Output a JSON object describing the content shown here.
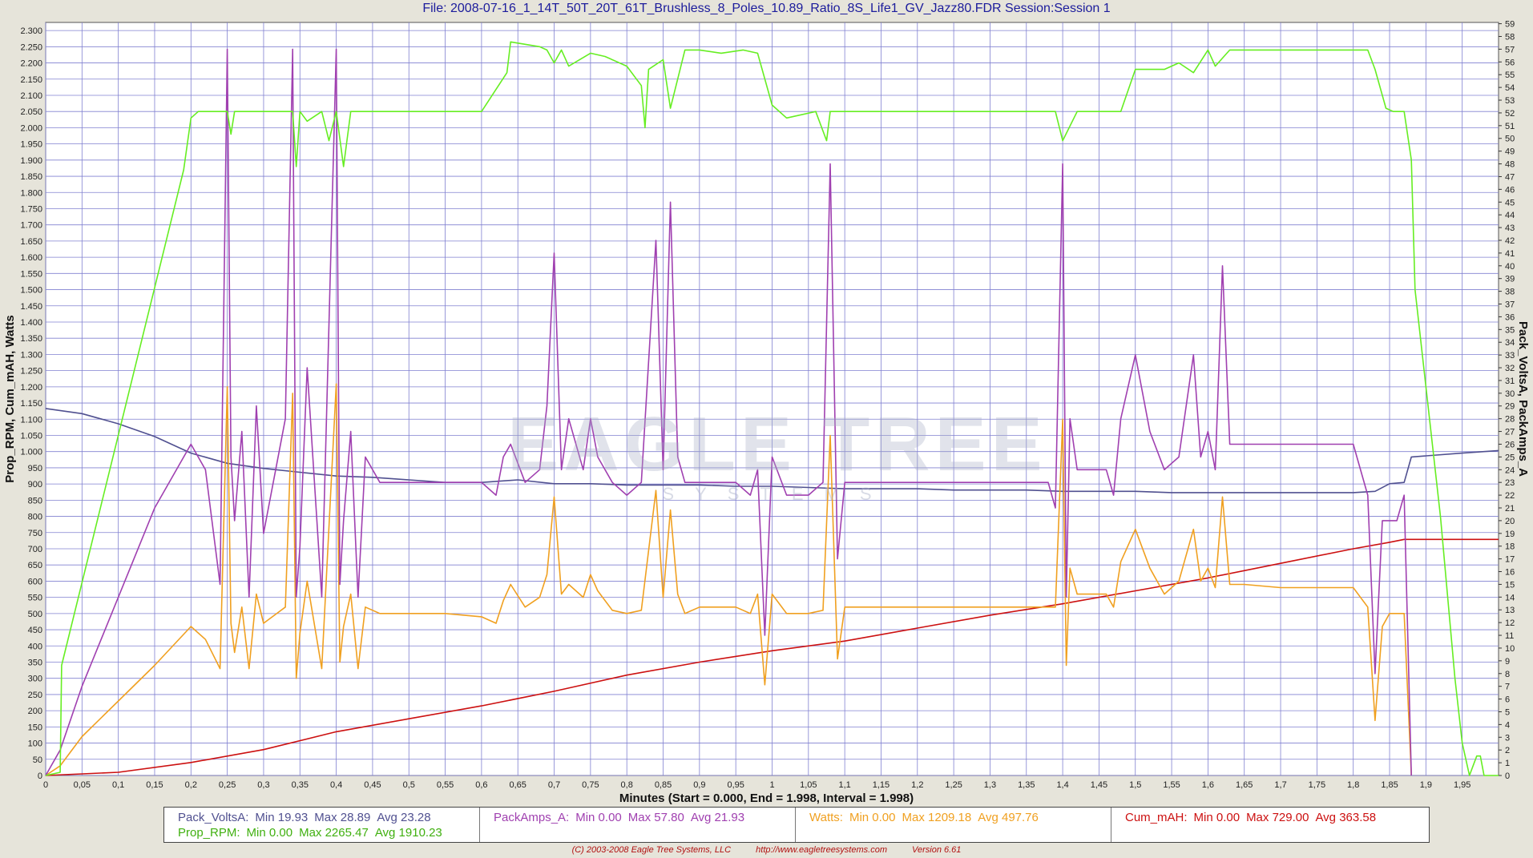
{
  "title": "File: 2008-07-16_1_14T_50T_20T_61T_Brushless_8_Poles_10.89_Ratio_8S_Life1_GV_Jazz80.FDR   Session:Session 1",
  "watermark": "EAGLE TREE",
  "watermark_sub": "SYSTEMS",
  "xlabel": "Minutes (Start = 0.000,  End = 1.998,  Interval =  1.998)",
  "ylabel_left": "Prop_RPM, Cum_mAH, Watts",
  "ylabel_right": "Pack_VoltsA, PackAmps_A",
  "footer": {
    "copyright": "(C) 2003-2008 Eagle Tree Systems, LLC",
    "url": "http://www.eagletreesystems.com",
    "version": "Version 6.61"
  },
  "legend": {
    "volts": {
      "name": "Pack_VoltsA:",
      "min": "Min 19.93",
      "max": "Max 28.89",
      "avg": "Avg 23.28"
    },
    "rpm": {
      "name": "Prop_RPM:",
      "min": "Min 0.00",
      "max": "Max 2265.47",
      "avg": "Avg 1910.23"
    },
    "amps": {
      "name": "PackAmps_A:",
      "min": "Min 0.00",
      "max": "Max 57.80",
      "avg": "Avg 21.93"
    },
    "watts": {
      "name": "Watts:",
      "min": "Min 0.00",
      "max": "Max 1209.18",
      "avg": "Avg 497.76"
    },
    "mah": {
      "name": "Cum_mAH:",
      "min": "Min 0.00",
      "max": "Max 729.00",
      "avg": "Avg 363.58"
    }
  },
  "colors": {
    "rpm": "#66ee22",
    "volts": "#505090",
    "amps": "#a040b0",
    "watts": "#f0a020",
    "mah": "#cc1010",
    "grid": "#8080d0",
    "plot_bg": "#ffffff"
  },
  "chart_data": {
    "type": "line",
    "grid": true,
    "x_ticks": [
      "0",
      "0,05",
      "0,1",
      "0,15",
      "0,2",
      "0,25",
      "0,3",
      "0,35",
      "0,4",
      "0,45",
      "0,5",
      "0,55",
      "0,6",
      "0,65",
      "0,7",
      "0,75",
      "0,8",
      "0,85",
      "0,9",
      "0,95",
      "1",
      "1,05",
      "1,1",
      "1,15",
      "1,2",
      "1,25",
      "1,3",
      "1,35",
      "1,4",
      "1,45",
      "1,5",
      "1,55",
      "1,6",
      "1,65",
      "1,7",
      "1,75",
      "1,8",
      "1,85",
      "1,9",
      "1,95"
    ],
    "xlim": [
      0,
      2.0
    ],
    "y_left_ticks": [
      "0",
      "50",
      "100",
      "150",
      "200",
      "250",
      "300",
      "350",
      "400",
      "450",
      "500",
      "550",
      "600",
      "650",
      "700",
      "750",
      "800",
      "850",
      "900",
      "950",
      "1.000",
      "1.050",
      "1.100",
      "1.150",
      "1.200",
      "1.250",
      "1.300",
      "1.350",
      "1.400",
      "1.450",
      "1.500",
      "1.550",
      "1.600",
      "1.650",
      "1.700",
      "1.750",
      "1.800",
      "1.850",
      "1.900",
      "1.950",
      "2.000",
      "2.050",
      "2.100",
      "2.150",
      "2.200",
      "2.250",
      "2.300"
    ],
    "ylim_left": [
      0,
      2325
    ],
    "y_right_ticks": [
      "0",
      "1",
      "2",
      "3",
      "4",
      "5",
      "6",
      "7",
      "8",
      "9",
      "10",
      "11",
      "12",
      "13",
      "14",
      "15",
      "16",
      "17",
      "18",
      "19",
      "20",
      "21",
      "22",
      "23",
      "24",
      "25",
      "26",
      "27",
      "28",
      "29",
      "30",
      "31",
      "32",
      "33",
      "34",
      "35",
      "36",
      "37",
      "38",
      "39",
      "40",
      "41",
      "42",
      "43",
      "44",
      "45",
      "46",
      "47",
      "48",
      "49",
      "50",
      "51",
      "52",
      "53",
      "54",
      "55",
      "56",
      "57",
      "58",
      "59"
    ],
    "ylim_right": [
      0,
      59.1
    ],
    "series": [
      {
        "name": "Prop_RPM",
        "axis": "left",
        "x": [
          0,
          0.02,
          0.022,
          0.19,
          0.2,
          0.21,
          0.25,
          0.255,
          0.26,
          0.3,
          0.34,
          0.345,
          0.35,
          0.36,
          0.38,
          0.39,
          0.4,
          0.41,
          0.42,
          0.6,
          0.635,
          0.64,
          0.68,
          0.69,
          0.7,
          0.71,
          0.72,
          0.75,
          0.77,
          0.8,
          0.82,
          0.825,
          0.83,
          0.85,
          0.86,
          0.88,
          0.9,
          0.93,
          0.96,
          0.98,
          1.0,
          1.02,
          1.06,
          1.075,
          1.08,
          1.1,
          1.35,
          1.39,
          1.4,
          1.42,
          1.44,
          1.45,
          1.47,
          1.48,
          1.5,
          1.54,
          1.56,
          1.58,
          1.6,
          1.61,
          1.63,
          1.65,
          1.72,
          1.8,
          1.82,
          1.83,
          1.845,
          1.855,
          1.87,
          1.88,
          1.885,
          1.92,
          1.94,
          1.95,
          1.96,
          1.97,
          1.975,
          1.98,
          2.0
        ],
        "y": [
          0,
          10,
          340,
          1870,
          2030,
          2050,
          2050,
          1980,
          2050,
          2050,
          2050,
          1880,
          2050,
          2020,
          2050,
          1960,
          2050,
          1880,
          2050,
          2050,
          2170,
          2265,
          2250,
          2240,
          2200,
          2240,
          2190,
          2230,
          2220,
          2190,
          2130,
          2000,
          2180,
          2210,
          2060,
          2240,
          2240,
          2230,
          2240,
          2230,
          2070,
          2030,
          2050,
          1960,
          2050,
          2050,
          2050,
          2050,
          1960,
          2050,
          2050,
          2050,
          2050,
          2050,
          2180,
          2180,
          2200,
          2170,
          2240,
          2190,
          2240,
          2240,
          2240,
          2240,
          2240,
          2180,
          2060,
          2050,
          2050,
          1900,
          1500,
          800,
          300,
          100,
          0,
          60,
          60,
          0,
          0
        ]
      },
      {
        "name": "Pack_VoltsA",
        "axis": "right",
        "x": [
          0,
          0.05,
          0.1,
          0.15,
          0.2,
          0.25,
          0.3,
          0.35,
          0.4,
          0.45,
          0.5,
          0.55,
          0.6,
          0.65,
          0.7,
          0.75,
          0.8,
          0.85,
          0.9,
          0.95,
          1.0,
          1.05,
          1.1,
          1.15,
          1.2,
          1.25,
          1.3,
          1.35,
          1.4,
          1.45,
          1.5,
          1.55,
          1.6,
          1.65,
          1.7,
          1.75,
          1.8,
          1.83,
          1.85,
          1.87,
          1.88,
          1.95,
          2.0
        ],
        "y": [
          28.8,
          28.4,
          27.6,
          26.6,
          25.3,
          24.5,
          24.1,
          23.8,
          23.5,
          23.4,
          23.2,
          23.0,
          23.0,
          23.2,
          22.9,
          22.9,
          22.8,
          22.8,
          22.8,
          22.7,
          22.7,
          22.6,
          22.5,
          22.5,
          22.5,
          22.4,
          22.4,
          22.4,
          22.3,
          22.3,
          22.3,
          22.2,
          22.2,
          22.2,
          22.2,
          22.2,
          22.2,
          22.3,
          22.9,
          23.0,
          25.0,
          25.3,
          25.5
        ]
      },
      {
        "name": "PackAmps_A",
        "axis": "right",
        "x": [
          0,
          0.02,
          0.05,
          0.1,
          0.15,
          0.2,
          0.22,
          0.24,
          0.25,
          0.255,
          0.26,
          0.27,
          0.28,
          0.29,
          0.3,
          0.33,
          0.34,
          0.345,
          0.35,
          0.36,
          0.38,
          0.4,
          0.405,
          0.41,
          0.42,
          0.43,
          0.44,
          0.46,
          0.48,
          0.5,
          0.55,
          0.6,
          0.62,
          0.63,
          0.64,
          0.66,
          0.68,
          0.69,
          0.7,
          0.71,
          0.72,
          0.74,
          0.75,
          0.76,
          0.78,
          0.8,
          0.82,
          0.84,
          0.85,
          0.86,
          0.87,
          0.88,
          0.9,
          0.95,
          0.97,
          0.98,
          0.99,
          1.0,
          1.02,
          1.05,
          1.07,
          1.08,
          1.09,
          1.1,
          1.15,
          1.2,
          1.25,
          1.3,
          1.35,
          1.38,
          1.39,
          1.4,
          1.405,
          1.41,
          1.42,
          1.44,
          1.46,
          1.47,
          1.48,
          1.5,
          1.52,
          1.54,
          1.56,
          1.58,
          1.59,
          1.6,
          1.61,
          1.62,
          1.63,
          1.65,
          1.7,
          1.75,
          1.8,
          1.82,
          1.83,
          1.84,
          1.85,
          1.86,
          1.87,
          1.88
        ],
        "y": [
          0,
          2,
          7,
          14,
          21,
          26,
          24,
          15,
          57,
          25,
          20,
          27,
          14,
          29,
          19,
          28,
          57,
          14,
          18,
          32,
          14,
          57,
          15,
          20,
          27,
          14,
          25,
          23,
          23,
          23,
          23,
          23,
          22,
          25,
          26,
          23,
          24,
          29,
          41,
          24,
          28,
          24,
          28,
          25,
          23,
          22,
          23,
          42,
          24,
          45,
          25,
          23,
          23,
          23,
          22,
          24,
          11,
          25,
          22,
          22,
          23,
          48,
          17,
          23,
          23,
          23,
          23,
          23,
          23,
          23,
          21,
          48,
          14,
          28,
          24,
          24,
          24,
          22,
          28,
          33,
          27,
          24,
          25,
          33,
          25,
          27,
          24,
          40,
          26,
          26,
          26,
          26,
          26,
          22,
          8,
          20,
          20,
          20,
          22,
          0
        ]
      },
      {
        "name": "Watts",
        "axis": "left",
        "x": [
          0,
          0.02,
          0.05,
          0.1,
          0.15,
          0.2,
          0.22,
          0.24,
          0.25,
          0.255,
          0.26,
          0.27,
          0.28,
          0.29,
          0.3,
          0.33,
          0.34,
          0.345,
          0.35,
          0.36,
          0.38,
          0.4,
          0.405,
          0.41,
          0.42,
          0.43,
          0.44,
          0.46,
          0.48,
          0.5,
          0.55,
          0.6,
          0.62,
          0.63,
          0.64,
          0.66,
          0.68,
          0.69,
          0.7,
          0.71,
          0.72,
          0.74,
          0.75,
          0.76,
          0.78,
          0.8,
          0.82,
          0.84,
          0.85,
          0.86,
          0.87,
          0.88,
          0.9,
          0.95,
          0.97,
          0.98,
          0.99,
          1.0,
          1.02,
          1.05,
          1.07,
          1.08,
          1.09,
          1.1,
          1.15,
          1.2,
          1.25,
          1.3,
          1.35,
          1.38,
          1.39,
          1.4,
          1.405,
          1.41,
          1.42,
          1.44,
          1.46,
          1.47,
          1.48,
          1.5,
          1.52,
          1.54,
          1.56,
          1.58,
          1.59,
          1.6,
          1.61,
          1.62,
          1.63,
          1.65,
          1.7,
          1.75,
          1.8,
          1.82,
          1.83,
          1.84,
          1.85,
          1.86,
          1.87,
          1.88
        ],
        "y": [
          0,
          30,
          120,
          230,
          340,
          460,
          420,
          330,
          1200,
          470,
          380,
          520,
          330,
          560,
          470,
          520,
          1180,
          300,
          440,
          600,
          330,
          1209,
          350,
          460,
          560,
          330,
          520,
          500,
          500,
          500,
          500,
          490,
          470,
          540,
          590,
          520,
          550,
          620,
          860,
          560,
          590,
          550,
          620,
          570,
          510,
          500,
          510,
          880,
          550,
          820,
          560,
          500,
          520,
          520,
          500,
          560,
          280,
          560,
          500,
          500,
          510,
          1050,
          360,
          520,
          520,
          520,
          520,
          520,
          520,
          520,
          520,
          1100,
          340,
          640,
          560,
          560,
          560,
          520,
          660,
          760,
          640,
          560,
          600,
          760,
          600,
          640,
          580,
          860,
          590,
          590,
          580,
          580,
          580,
          520,
          170,
          460,
          500,
          500,
          500,
          0
        ]
      },
      {
        "name": "Cum_mAH",
        "axis": "left",
        "x": [
          0,
          0.1,
          0.2,
          0.3,
          0.4,
          0.5,
          0.6,
          0.7,
          0.8,
          0.9,
          1.0,
          1.1,
          1.2,
          1.3,
          1.4,
          1.5,
          1.6,
          1.7,
          1.8,
          1.85,
          1.87,
          2.0
        ],
        "y": [
          0,
          10,
          40,
          80,
          135,
          175,
          215,
          260,
          310,
          350,
          385,
          415,
          455,
          495,
          530,
          570,
          610,
          655,
          700,
          720,
          729,
          729
        ]
      }
    ]
  }
}
